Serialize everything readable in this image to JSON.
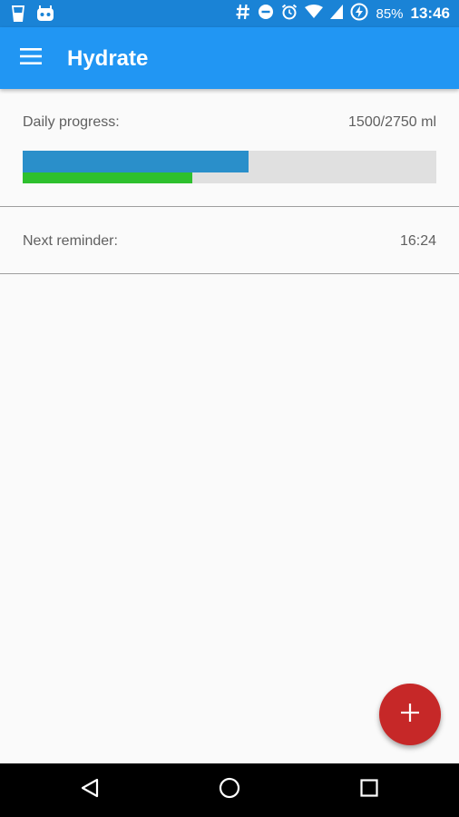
{
  "status_bar": {
    "icons_left": [
      "cup-icon",
      "android-icon"
    ],
    "icons_right": [
      "hash-icon",
      "do-not-disturb-icon",
      "alarm-icon",
      "wifi-icon",
      "signal-icon",
      "battery-charging-icon"
    ],
    "battery": "85%",
    "time": "13:46"
  },
  "app_bar": {
    "title": "Hydrate",
    "menu_icon": "hamburger-menu-icon"
  },
  "progress": {
    "label": "Daily progress:",
    "value_text": "1500/2750 ml",
    "current_ml": 1500,
    "goal_ml": 2750,
    "blue_fill_fraction": 0.546,
    "green_fill_fraction": 0.41
  },
  "reminder": {
    "label": "Next reminder:",
    "time": "16:24"
  },
  "fab": {
    "icon": "plus-icon"
  },
  "colors": {
    "status_bar": "#1a83d6",
    "app_bar": "#2196f3",
    "progress_blue": "#2a8fca",
    "progress_green": "#2ec02e",
    "fab": "#c62828"
  },
  "nav_bar": {
    "buttons": [
      "back-icon",
      "home-icon",
      "recents-icon"
    ]
  }
}
